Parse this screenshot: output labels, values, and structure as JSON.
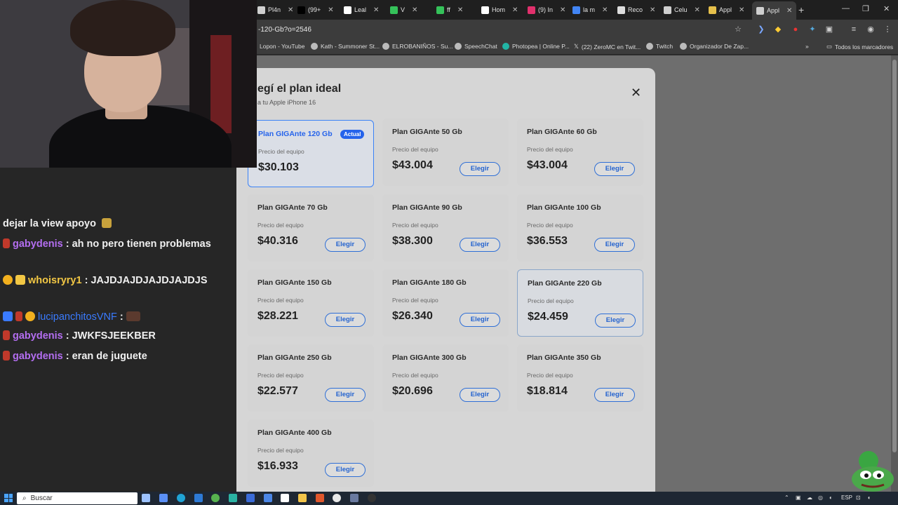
{
  "browser": {
    "tabs": [
      {
        "label": "Pl4n",
        "color": "#d0d0d0"
      },
      {
        "label": "(99+",
        "color": "#000000"
      },
      {
        "label": "Leal",
        "color": "#ffffff"
      },
      {
        "label": "V",
        "color": "#35c25a"
      },
      {
        "label": "ff",
        "color": "#35c25a"
      },
      {
        "label": "Hom",
        "color": "#ffffff"
      },
      {
        "label": "(9) In",
        "color": "#e1306c"
      },
      {
        "label": "la m",
        "color": "#4285f4"
      },
      {
        "label": "Reco",
        "color": "#dddddd"
      },
      {
        "label": "Celu",
        "color": "#cfcfcf"
      },
      {
        "label": "Appl",
        "color": "#e6c04b"
      },
      {
        "label": "Appl",
        "color": "#cfcfcf"
      }
    ],
    "url": "-120-Gb?o=2546",
    "bookmarks": [
      "Lopon - YouTube",
      "Kath - Summoner St...",
      "ELROBANIÑOS - Su...",
      "SpeechChat",
      "Photopea | Online P...",
      "(22) ZeroMC en Twit...",
      "Twitch",
      "Organizador De Zap...",
      "Todos los marcadores"
    ]
  },
  "modal": {
    "title": "egí el plan ideal",
    "subtitle": "a tu Apple iPhone 16",
    "price_label": "Precio del equipo",
    "choose_label": "Elegir",
    "current_badge": "Actual",
    "plans": [
      {
        "name": "Plan GIGAnte 120 Gb",
        "price": "$30.103",
        "current": true
      },
      {
        "name": "Plan GIGAnte 50 Gb",
        "price": "$43.004"
      },
      {
        "name": "Plan GIGAnte 60 Gb",
        "price": "$43.004"
      },
      {
        "name": "Plan GIGAnte 70 Gb",
        "price": "$40.316"
      },
      {
        "name": "Plan GIGAnte 90 Gb",
        "price": "$38.300"
      },
      {
        "name": "Plan GIGAnte 100 Gb",
        "price": "$36.553"
      },
      {
        "name": "Plan GIGAnte 150 Gb",
        "price": "$28.221"
      },
      {
        "name": "Plan GIGAnte 180 Gb",
        "price": "$26.340"
      },
      {
        "name": "Plan GIGAnte 220 Gb",
        "price": "$24.459",
        "hover": true
      },
      {
        "name": "Plan GIGAnte 250 Gb",
        "price": "$22.577"
      },
      {
        "name": "Plan GIGAnte 300 Gb",
        "price": "$20.696"
      },
      {
        "name": "Plan GIGAnte 350 Gb",
        "price": "$18.814"
      },
      {
        "name": "Plan GIGAnte 400 Gb",
        "price": "$16.933"
      }
    ]
  },
  "chat": {
    "messages": [
      {
        "user": "",
        "text": "dejar la view apoyo",
        "user_color": "#f0f0f0"
      },
      {
        "user": "gabydenis",
        "text": ": ah no pero tienen problemas",
        "user_color": "#b36ef0"
      },
      {
        "user": "whoisryry1",
        "text": ": JAJDJAJDJAJDJAJDJS",
        "user_color": "#f2c744"
      },
      {
        "user": "lucipanchitosVNF",
        "text": ":",
        "user_color": "#3a7bff"
      },
      {
        "user": "gabydenis",
        "text": ": JWKFSJEEKBER",
        "user_color": "#b36ef0"
      },
      {
        "user": "gabydenis",
        "text": ": eran de juguete",
        "user_color": "#b36ef0"
      }
    ]
  },
  "taskbar": {
    "search_placeholder": "Buscar",
    "lang": "ESP"
  }
}
